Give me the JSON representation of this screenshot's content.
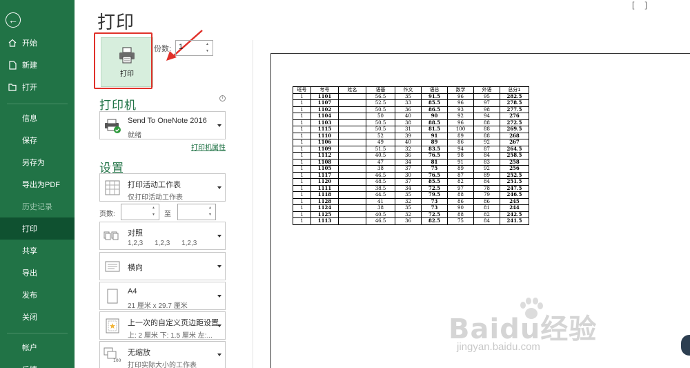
{
  "sidebar": {
    "items": [
      {
        "label": "开始",
        "icon": "home-icon"
      },
      {
        "label": "新建",
        "icon": "new-file-icon"
      },
      {
        "label": "打开",
        "icon": "open-folder-icon"
      },
      {
        "label": "信息"
      },
      {
        "label": "保存"
      },
      {
        "label": "另存为"
      },
      {
        "label": "导出为PDF"
      },
      {
        "label": "历史记录"
      },
      {
        "label": "打印"
      },
      {
        "label": "共享"
      },
      {
        "label": "导出"
      },
      {
        "label": "发布"
      },
      {
        "label": "关闭"
      },
      {
        "label": "帐户"
      },
      {
        "label": "反馈"
      }
    ]
  },
  "header": {
    "title": "打印",
    "top_marks": "[ ]"
  },
  "print_button": {
    "label": "打印"
  },
  "copies": {
    "label": "份数:",
    "value": "1"
  },
  "printer": {
    "section_title": "打印机",
    "name": "Send To OneNote 2016",
    "status": "就绪",
    "properties_link": "打印机属性"
  },
  "settings": {
    "section_title": "设置",
    "scope": {
      "title": "打印活动工作表",
      "subtitle": "仅打印活动工作表"
    },
    "pages_label": "页数:",
    "to_label": "至",
    "collate": {
      "title": "对照",
      "subtitle": "1,2,3 1,2,3 1,2,3"
    },
    "orientation": {
      "title": "横向"
    },
    "paper": {
      "title": "A4",
      "subtitle": "21 厘米 x 29.7 厘米"
    },
    "margins": {
      "title": "上一次的自定义页边距设置",
      "subtitle": "上: 2 厘米 下: 1.5 厘米 左:..."
    },
    "scaling": {
      "title": "无缩放",
      "subtitle": "打印实际大小的工作表"
    }
  },
  "sheet": {
    "headers": [
      "班号",
      "考号",
      "姓名",
      "语基",
      "作文",
      "语总",
      "数学",
      "外语",
      "总分1"
    ],
    "rows": [
      [
        "1",
        "1101",
        "",
        "56.5",
        "35",
        "91.5",
        "96",
        "95",
        "282.5"
      ],
      [
        "1",
        "1107",
        "",
        "52.5",
        "33",
        "85.5",
        "96",
        "97",
        "278.5"
      ],
      [
        "1",
        "1102",
        "",
        "50.5",
        "36",
        "86.5",
        "93",
        "98",
        "277.5"
      ],
      [
        "1",
        "1104",
        "",
        "50",
        "40",
        "90",
        "92",
        "94",
        "276"
      ],
      [
        "1",
        "1103",
        "",
        "50.5",
        "38",
        "88.5",
        "96",
        "88",
        "272.5"
      ],
      [
        "1",
        "1115",
        "",
        "50.5",
        "31",
        "81.5",
        "100",
        "88",
        "269.5"
      ],
      [
        "1",
        "1110",
        "",
        "52",
        "39",
        "91",
        "89",
        "88",
        "268"
      ],
      [
        "1",
        "1106",
        "",
        "49",
        "40",
        "89",
        "86",
        "92",
        "267"
      ],
      [
        "1",
        "1109",
        "",
        "51.5",
        "32",
        "83.5",
        "94",
        "87",
        "264.5"
      ],
      [
        "1",
        "1112",
        "",
        "40.5",
        "36",
        "76.5",
        "98",
        "84",
        "258.5"
      ],
      [
        "1",
        "1108",
        "",
        "47",
        "34",
        "81",
        "91",
        "83",
        "258"
      ],
      [
        "1",
        "1105",
        "",
        "38",
        "37",
        "75",
        "89",
        "92",
        "256"
      ],
      [
        "1",
        "1117",
        "",
        "46.5",
        "30",
        "76.5",
        "87",
        "89",
        "252.5"
      ],
      [
        "1",
        "1120",
        "",
        "48.5",
        "37",
        "85.5",
        "82",
        "84",
        "251.5"
      ],
      [
        "1",
        "1111",
        "",
        "38.5",
        "34",
        "72.5",
        "97",
        "78",
        "247.5"
      ],
      [
        "1",
        "1118",
        "",
        "44.5",
        "35",
        "79.5",
        "88",
        "79",
        "246.5"
      ],
      [
        "1",
        "1128",
        "",
        "41",
        "32",
        "73",
        "86",
        "86",
        "245"
      ],
      [
        "1",
        "1124",
        "",
        "38",
        "35",
        "73",
        "90",
        "81",
        "244"
      ],
      [
        "1",
        "1125",
        "",
        "40.5",
        "32",
        "72.5",
        "88",
        "82",
        "242.5"
      ],
      [
        "1",
        "1113",
        "",
        "46.5",
        "36",
        "82.5",
        "75",
        "84",
        "241.5"
      ]
    ]
  },
  "watermark": {
    "brand": "Baidu经验",
    "sub": "jingyan.baidu.com"
  },
  "colors": {
    "brand_green": "#217346",
    "active_nav": "#0f5130",
    "highlight_red": "#e0312a"
  }
}
